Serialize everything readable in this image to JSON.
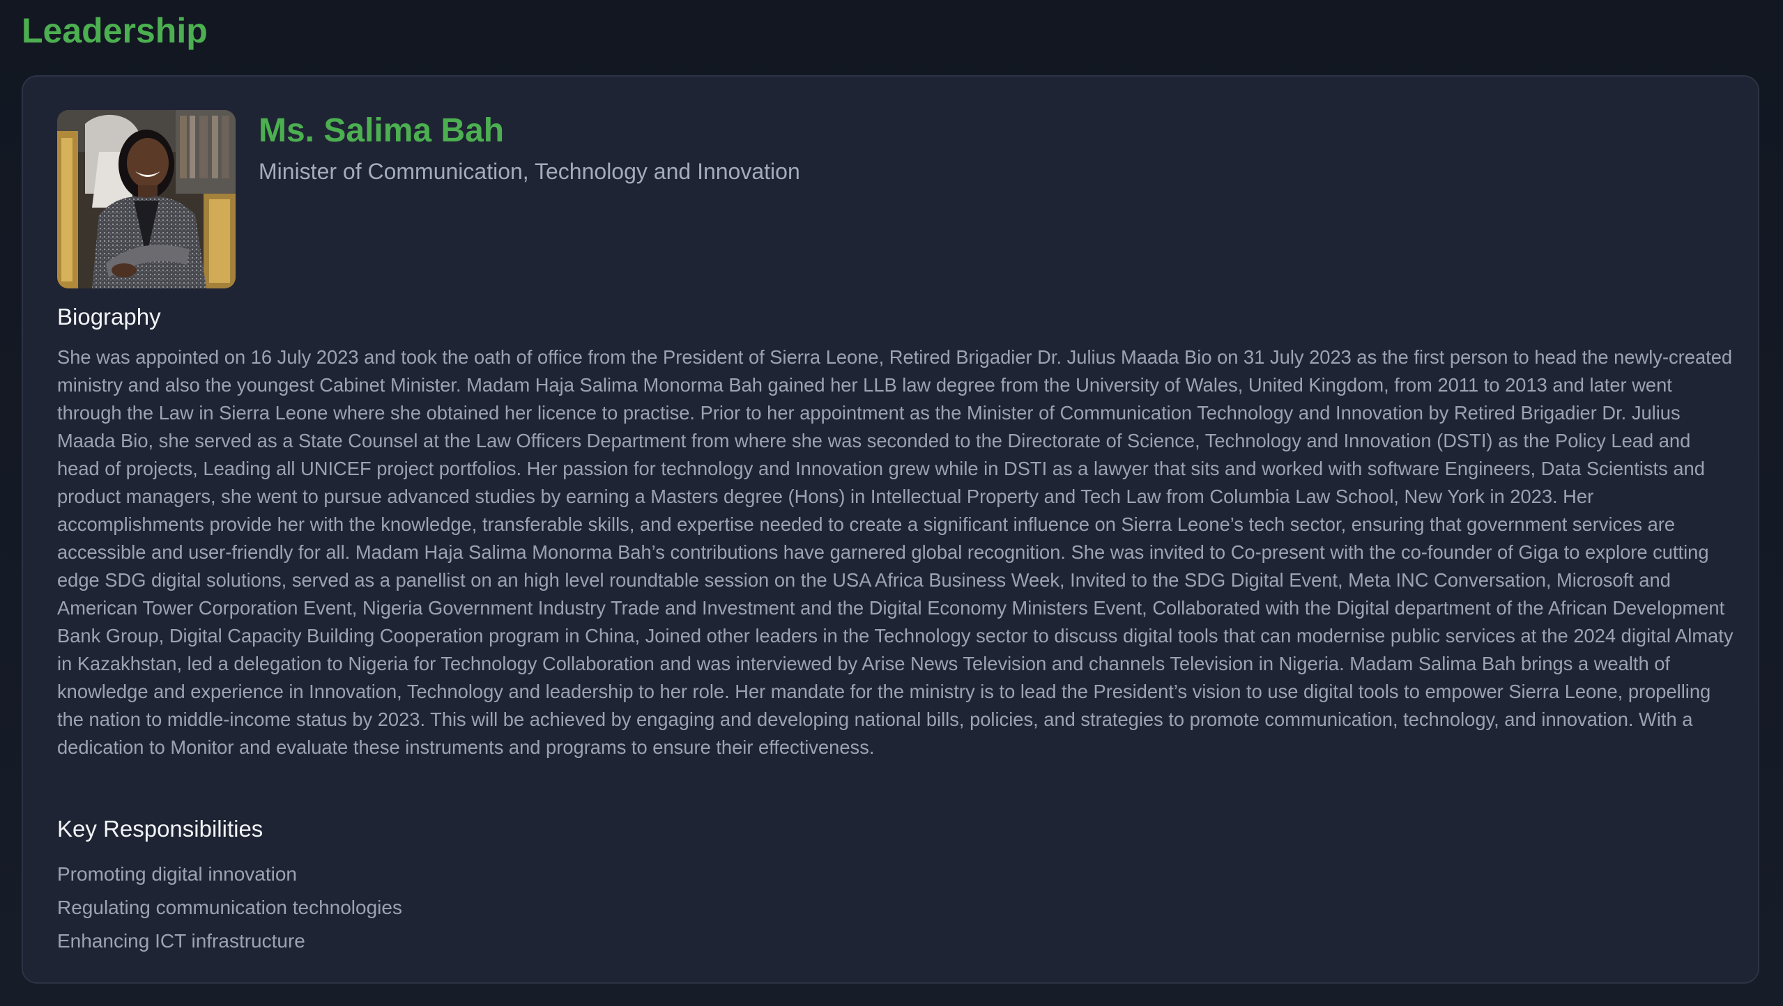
{
  "page": {
    "title": "Leadership"
  },
  "leader": {
    "name": "Ms. Salima Bah",
    "role": "Minister of Communication, Technology and Innovation",
    "photo_icon": "portrait-photo"
  },
  "biography": {
    "heading": "Biography",
    "text": "She was appointed on 16 July 2023 and took the oath of office from the President of Sierra Leone, Retired Brigadier Dr. Julius Maada Bio on 31 July 2023 as the first person to head the newly-created ministry and also the youngest Cabinet Minister. Madam Haja Salima Monorma Bah gained her LLB law degree from the University of Wales, United Kingdom, from 2011 to 2013 and later went through the Law in Sierra Leone where she obtained her licence to practise. Prior to her appointment as the Minister of Communication Technology and Innovation by Retired Brigadier Dr. Julius Maada Bio, she served as a State Counsel at the Law Officers Department from where she was seconded to the Directorate of Science, Technology and Innovation (DSTI) as the Policy Lead and head of projects, Leading all UNICEF project portfolios. Her passion for technology and Innovation grew while in DSTI as a lawyer that sits and worked with software Engineers, Data Scientists and product managers, she went to pursue advanced studies by earning a Masters degree (Hons) in Intellectual Property and Tech Law from Columbia Law School, New York in 2023. Her accomplishments provide her with the knowledge, transferable skills, and expertise needed to create a significant influence on Sierra Leone’s tech sector, ensuring that government services are accessible and user-friendly for all. Madam Haja Salima Monorma Bah’s contributions have garnered global recognition. She was invited to Co-present with the co-founder of Giga to explore cutting edge SDG digital solutions, served as a panellist on an high level roundtable session on the USA Africa Business Week, Invited to the SDG Digital Event, Meta INC Conversation, Microsoft and American Tower Corporation Event, Nigeria Government Industry Trade and Investment and the Digital Economy Ministers Event, Collaborated with the Digital department of the African Development Bank Group, Digital Capacity Building Cooperation program in China, Joined other leaders in the Technology sector to discuss digital tools that can modernise public services at the 2024 digital Almaty in Kazakhstan, led a delegation to Nigeria for Technology Collaboration and was interviewed by Arise News Television and channels Television in Nigeria. Madam Salima Bah brings a wealth of knowledge and experience in Innovation, Technology and leadership to her role. Her mandate for the ministry is to lead the President’s vision to use digital tools to empower Sierra Leone, propelling the nation to middle-income status by 2023. This will be achieved by engaging and developing national bills, policies, and strategies to promote communication, technology, and innovation. With a dedication to Monitor and evaluate these instruments and programs to ensure their effectiveness."
  },
  "responsibilities": {
    "heading": "Key Responsibilities",
    "items": [
      "Promoting digital innovation",
      "Regulating communication technologies",
      "Enhancing ICT infrastructure"
    ]
  },
  "colors": {
    "accent": "#4caf50",
    "background": "#141a25",
    "card": "#1f2434",
    "body_text": "#9ba3b2",
    "heading_text": "#f1f3f6"
  }
}
